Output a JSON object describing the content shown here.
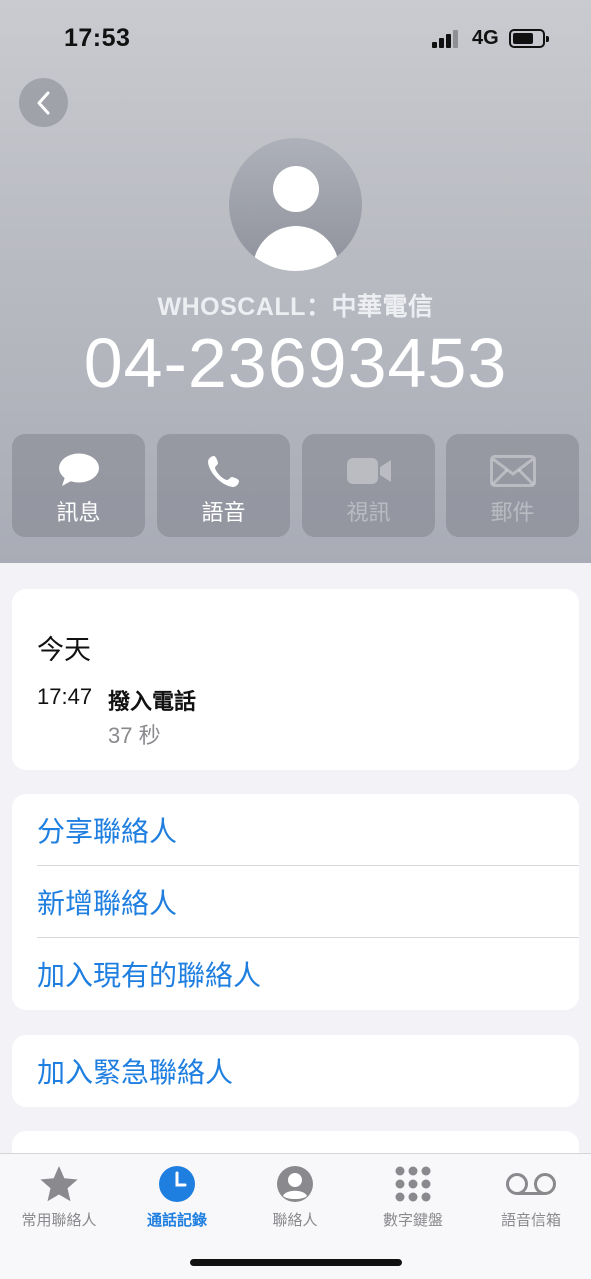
{
  "status_bar": {
    "time": "17:53",
    "network": "4G"
  },
  "contact": {
    "caller_label": "WHOSCALL：中華電信",
    "phone_number": "04-23693453"
  },
  "actions": [
    {
      "label": "訊息",
      "icon": "message-bubble-icon",
      "enabled": true
    },
    {
      "label": "語音",
      "icon": "phone-icon",
      "enabled": true
    },
    {
      "label": "視訊",
      "icon": "video-camera-icon",
      "enabled": false
    },
    {
      "label": "郵件",
      "icon": "mail-envelope-icon",
      "enabled": false
    }
  ],
  "recent": {
    "day": "今天",
    "time": "17:47",
    "type": "撥入電話",
    "duration": "37 秒"
  },
  "options": [
    "分享聯絡人",
    "新增聯絡人",
    "加入現有的聯絡人"
  ],
  "emergency": "加入緊急聯絡人",
  "tab_bar": {
    "active": "通話記錄",
    "items": [
      {
        "label": "常用聯絡人",
        "icon": "star-icon"
      },
      {
        "label": "通話記錄",
        "icon": "clock-icon"
      },
      {
        "label": "聯絡人",
        "icon": "person-circle-icon"
      },
      {
        "label": "數字鍵盤",
        "icon": "keypad-icon"
      },
      {
        "label": "語音信箱",
        "icon": "voicemail-icon"
      }
    ]
  },
  "colors": {
    "accent": "#1f7fe0",
    "header_top": "#c9cbd0",
    "header_bottom": "#a9acb6"
  }
}
